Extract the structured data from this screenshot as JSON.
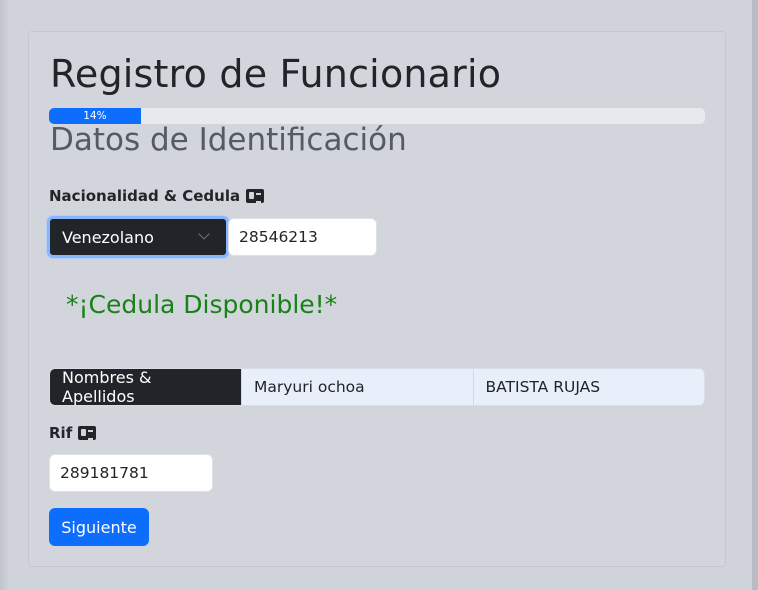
{
  "form": {
    "title": "Registro de Funcionario",
    "progress_percent": 14,
    "progress_label": "14%",
    "section_title": "Datos de Identificación"
  },
  "identification": {
    "label": "Nacionalidad & Cedula",
    "nationality_selected": "Venezolano",
    "cedula_value": "28546213",
    "availability_message": "*¡Cedula Disponible!*"
  },
  "names": {
    "label": "Nombres & Apellidos",
    "first_names_value": "Maryuri ochoa",
    "last_names_value": "BATISTA RUJAS"
  },
  "rif": {
    "label": "Rif",
    "value": "289181781"
  },
  "actions": {
    "next_label": "Siguiente"
  },
  "colors": {
    "primary": "#0d6efd",
    "success_text": "#198117",
    "dark": "#212529"
  }
}
